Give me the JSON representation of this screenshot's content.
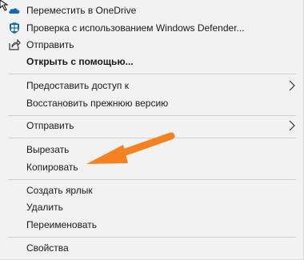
{
  "menu": {
    "items": [
      {
        "label": "Переместить в OneDrive",
        "icon": "onedrive-cloud-icon"
      },
      {
        "label": "Проверка с использованием Windows Defender...",
        "icon": "windows-defender-shield-icon"
      },
      {
        "label": "Отправить",
        "icon": "share-icon"
      },
      {
        "label": "Открыть с помощью..."
      },
      {
        "label": "Предоставить доступ к"
      },
      {
        "label": "Восстановить прежнюю версию"
      },
      {
        "label": "Отправить"
      },
      {
        "label": "Вырезать"
      },
      {
        "label": "Копировать"
      },
      {
        "label": "Создать ярлык"
      },
      {
        "label": "Удалить"
      },
      {
        "label": "Переименовать"
      },
      {
        "label": "Свойства"
      }
    ]
  },
  "annotation": {
    "arrow_color": "#f58220",
    "arrow_icon": "pointer-arrow-icon"
  },
  "colors": {
    "menu_bg": "#f2f2f2",
    "separator": "#cfcfcf",
    "onedrive_blue": "#0f6cbd",
    "defender_blue": "#1167b1"
  }
}
